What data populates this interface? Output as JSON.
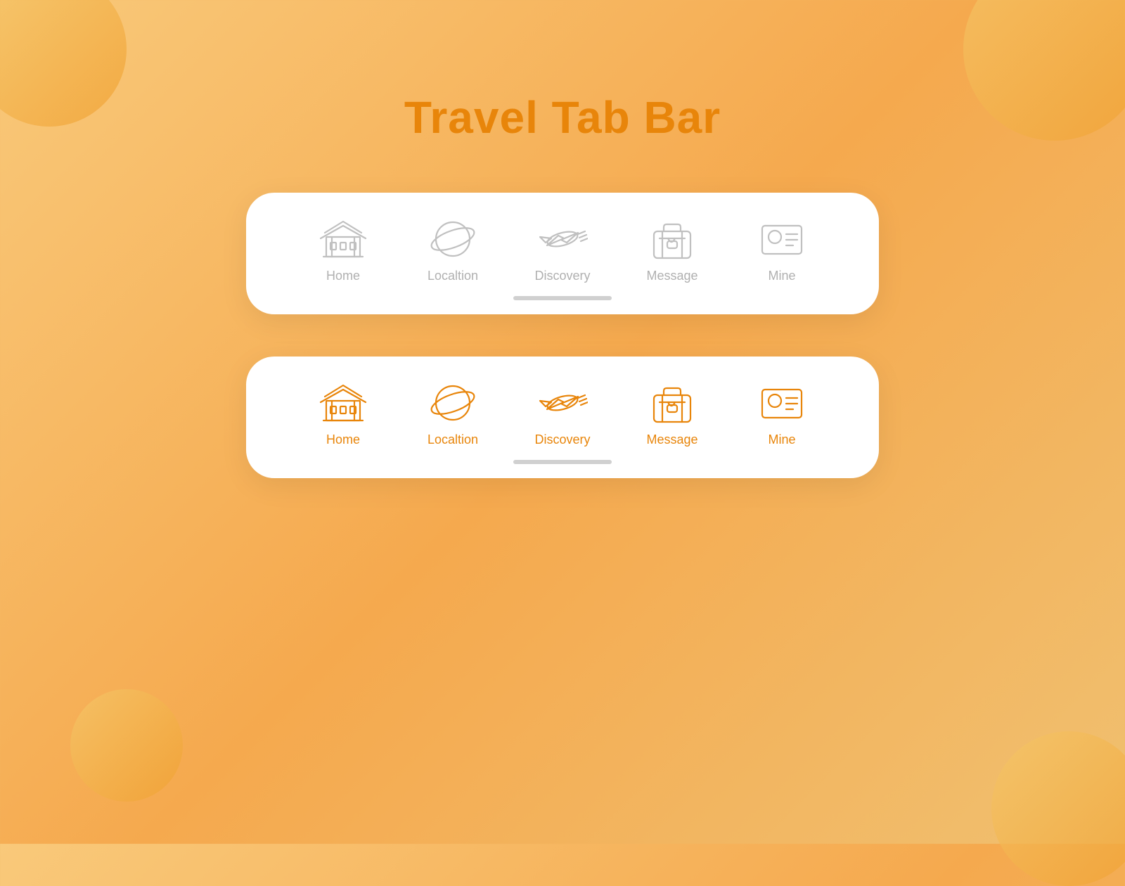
{
  "page": {
    "title": "Travel Tab Bar",
    "background_color": "#f5a94e"
  },
  "accent_color": "#e8850a",
  "inactive_color": "#c0c0c0",
  "tab_bars": [
    {
      "id": "inactive-bar",
      "state": "inactive",
      "tabs": [
        {
          "id": "home",
          "label": "Home"
        },
        {
          "id": "location",
          "label": "Localtion"
        },
        {
          "id": "discovery",
          "label": "Discovery"
        },
        {
          "id": "message",
          "label": "Message"
        },
        {
          "id": "mine",
          "label": "Mine"
        }
      ]
    },
    {
      "id": "active-bar",
      "state": "active",
      "tabs": [
        {
          "id": "home",
          "label": "Home"
        },
        {
          "id": "location",
          "label": "Localtion"
        },
        {
          "id": "discovery",
          "label": "Discovery"
        },
        {
          "id": "message",
          "label": "Message"
        },
        {
          "id": "mine",
          "label": "Mine"
        }
      ]
    }
  ]
}
